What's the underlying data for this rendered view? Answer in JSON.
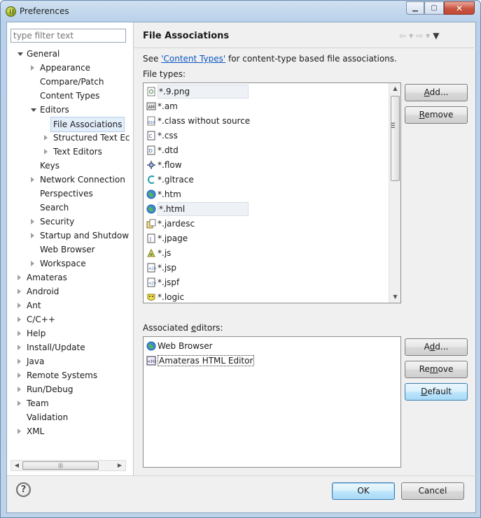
{
  "window": {
    "title": "Preferences"
  },
  "left": {
    "filter_placeholder": "type filter text",
    "tree": [
      {
        "label": "General",
        "depth": 0,
        "state": "open"
      },
      {
        "label": "Appearance",
        "depth": 1,
        "state": "closed"
      },
      {
        "label": "Compare/Patch",
        "depth": 1,
        "state": "leaf"
      },
      {
        "label": "Content Types",
        "depth": 1,
        "state": "leaf"
      },
      {
        "label": "Editors",
        "depth": 1,
        "state": "open"
      },
      {
        "label": "File Associations",
        "depth": 2,
        "state": "leaf",
        "selected": true
      },
      {
        "label": "Structured Text Ec",
        "depth": 2,
        "state": "closed"
      },
      {
        "label": "Text Editors",
        "depth": 2,
        "state": "closed"
      },
      {
        "label": "Keys",
        "depth": 1,
        "state": "leaf"
      },
      {
        "label": "Network Connection",
        "depth": 1,
        "state": "closed"
      },
      {
        "label": "Perspectives",
        "depth": 1,
        "state": "leaf"
      },
      {
        "label": "Search",
        "depth": 1,
        "state": "leaf"
      },
      {
        "label": "Security",
        "depth": 1,
        "state": "closed"
      },
      {
        "label": "Startup and Shutdow",
        "depth": 1,
        "state": "closed"
      },
      {
        "label": "Web Browser",
        "depth": 1,
        "state": "leaf"
      },
      {
        "label": "Workspace",
        "depth": 1,
        "state": "closed"
      },
      {
        "label": "Amateras",
        "depth": 0,
        "state": "closed"
      },
      {
        "label": "Android",
        "depth": 0,
        "state": "closed"
      },
      {
        "label": "Ant",
        "depth": 0,
        "state": "closed"
      },
      {
        "label": "C/C++",
        "depth": 0,
        "state": "closed"
      },
      {
        "label": "Help",
        "depth": 0,
        "state": "closed"
      },
      {
        "label": "Install/Update",
        "depth": 0,
        "state": "closed"
      },
      {
        "label": "Java",
        "depth": 0,
        "state": "closed"
      },
      {
        "label": "Remote Systems",
        "depth": 0,
        "state": "closed"
      },
      {
        "label": "Run/Debug",
        "depth": 0,
        "state": "closed"
      },
      {
        "label": "Team",
        "depth": 0,
        "state": "closed"
      },
      {
        "label": "Validation",
        "depth": 0,
        "state": "leaf"
      },
      {
        "label": "XML",
        "depth": 0,
        "state": "closed"
      }
    ]
  },
  "page": {
    "title": "File Associations",
    "info_prefix": "See ",
    "info_link": "'Content Types'",
    "info_suffix": " for content-type based file associations.",
    "file_types_label": "File types:",
    "file_types": [
      {
        "label": "*.9.png",
        "icon": "image-file-icon",
        "highlight": true
      },
      {
        "label": "*.am",
        "icon": "am-file-icon"
      },
      {
        "label": "*.class without source",
        "icon": "class-file-icon"
      },
      {
        "label": "*.css",
        "icon": "css-file-icon"
      },
      {
        "label": "*.dtd",
        "icon": "dtd-file-icon"
      },
      {
        "label": "*.flow",
        "icon": "flow-file-icon"
      },
      {
        "label": "*.gltrace",
        "icon": "gltrace-file-icon"
      },
      {
        "label": "*.htm",
        "icon": "globe-icon"
      },
      {
        "label": "*.html",
        "icon": "globe-icon",
        "highlight": true
      },
      {
        "label": "*.jardesc",
        "icon": "jardesc-file-icon"
      },
      {
        "label": "*.jpage",
        "icon": "jpage-file-icon"
      },
      {
        "label": "*.js",
        "icon": "js-file-icon"
      },
      {
        "label": "*.jsp",
        "icon": "jsp-file-icon"
      },
      {
        "label": "*.jspf",
        "icon": "jsp-file-icon"
      },
      {
        "label": "*.logic",
        "icon": "logic-file-icon"
      }
    ],
    "file_type_buttons": {
      "add_pre": "",
      "add_mn": "A",
      "add_post": "dd...",
      "remove_pre": "",
      "remove_mn": "R",
      "remove_post": "emove"
    },
    "editors_label_pre": "Associated ",
    "editors_label_mn": "e",
    "editors_label_post": "ditors:",
    "editors": [
      {
        "label": "Web Browser",
        "icon": "globe-icon"
      },
      {
        "label": "Amateras HTML Editor",
        "icon": "html-editor-icon",
        "selected": true
      }
    ],
    "editor_buttons": {
      "add_pre": "A",
      "add_mn": "d",
      "add_post": "d...",
      "remove_pre": "Re",
      "remove_mn": "m",
      "remove_post": "ove",
      "default_pre": "",
      "default_mn": "D",
      "default_post": "efault"
    }
  },
  "footer": {
    "ok_label": "OK",
    "cancel_label": "Cancel"
  },
  "colors": {
    "link": "#0a56c2",
    "selection": "#e3eefb",
    "close_button": "#c8553f"
  }
}
